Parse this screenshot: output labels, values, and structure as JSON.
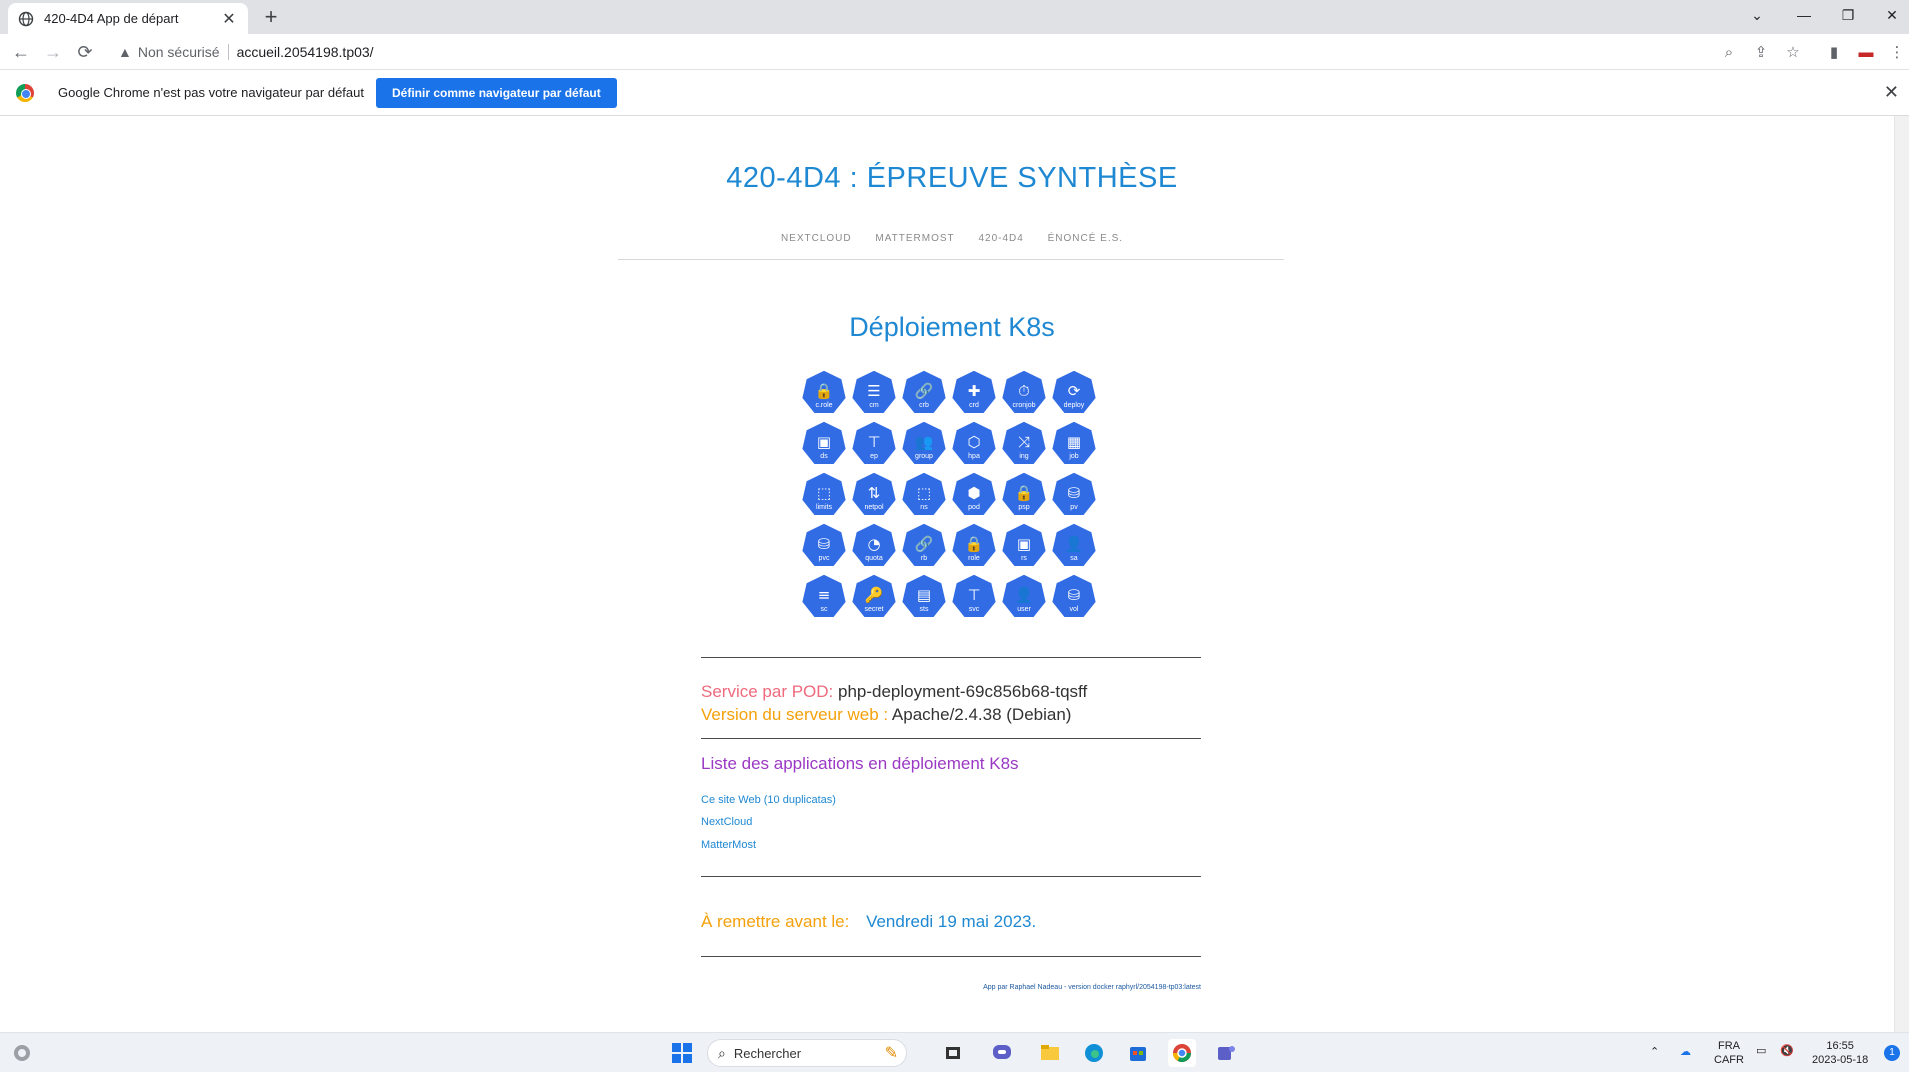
{
  "browser": {
    "tab_title": "420-4D4 App de départ",
    "tab_close": "✕",
    "new_tab": "+",
    "omnibox_security": "Non sécurisé",
    "url": "accueil.2054198.tp03/",
    "infobar_message": "Google Chrome n'est pas votre navigateur par défaut",
    "infobar_button": "Définir comme navigateur par défaut",
    "infobar_close": "✕"
  },
  "site": {
    "title": "420-4D4 : ÉPREUVE SYNTHÈSE",
    "nav": [
      "NEXTCLOUD",
      "MATTERMOST",
      "420-4D4",
      "ÉNONCÉ E.S."
    ],
    "heading": "Déploiement K8s"
  },
  "k8s_icons": [
    {
      "label": "c.role",
      "glyph": "🔒"
    },
    {
      "label": "cm",
      "glyph": "☰"
    },
    {
      "label": "crb",
      "glyph": "🔗"
    },
    {
      "label": "crd",
      "glyph": "✚"
    },
    {
      "label": "cronjob",
      "glyph": "⏱"
    },
    {
      "label": "deploy",
      "glyph": "⟳"
    },
    {
      "label": "ds",
      "glyph": "▣"
    },
    {
      "label": "ep",
      "glyph": "⊤"
    },
    {
      "label": "group",
      "glyph": "👥"
    },
    {
      "label": "hpa",
      "glyph": "⬡"
    },
    {
      "label": "ing",
      "glyph": "⤨"
    },
    {
      "label": "job",
      "glyph": "▦"
    },
    {
      "label": "limits",
      "glyph": "⬚"
    },
    {
      "label": "netpol",
      "glyph": "⇅"
    },
    {
      "label": "ns",
      "glyph": "⬚"
    },
    {
      "label": "pod",
      "glyph": "⬢"
    },
    {
      "label": "psp",
      "glyph": "🔒"
    },
    {
      "label": "pv",
      "glyph": "⛁"
    },
    {
      "label": "pvc",
      "glyph": "⛁"
    },
    {
      "label": "quota",
      "glyph": "◔"
    },
    {
      "label": "rb",
      "glyph": "🔗"
    },
    {
      "label": "role",
      "glyph": "🔒"
    },
    {
      "label": "rs",
      "glyph": "▣"
    },
    {
      "label": "sa",
      "glyph": "👤"
    },
    {
      "label": "sc",
      "glyph": "≡"
    },
    {
      "label": "secret",
      "glyph": "🔑"
    },
    {
      "label": "sts",
      "glyph": "▤"
    },
    {
      "label": "svc",
      "glyph": "⊤"
    },
    {
      "label": "user",
      "glyph": "👤"
    },
    {
      "label": "vol",
      "glyph": "⛁"
    }
  ],
  "info": {
    "pod_label": "Service par POD:",
    "pod_value": "php-deployment-69c856b68-tqsff",
    "server_label": "Version du serveur web :",
    "server_value": "Apache/2.4.38 (Debian)"
  },
  "apps": {
    "title": "Liste des applications en déploiement K8s",
    "links": [
      "Ce site Web (10 duplicatas)",
      "NextCloud",
      "MatterMost"
    ]
  },
  "deadline": {
    "label": "À remettre avant le:",
    "value": "Vendredi 19 mai 2023."
  },
  "footer": "App par Raphael Nadeau - version docker raphyrl/2054198-tp03:latest",
  "taskbar": {
    "search_placeholder": "Rechercher",
    "lang_top": "FRA",
    "lang_bottom": "CAFR",
    "time": "16:55",
    "date": "2023-05-18",
    "notif_count": "1"
  },
  "colors": {
    "accent": "#1e88d2",
    "k8s_blue": "#326ce5",
    "pod_label": "#ee6a7c",
    "server_label": "#f4a10b",
    "list_title": "#9b38c4"
  }
}
